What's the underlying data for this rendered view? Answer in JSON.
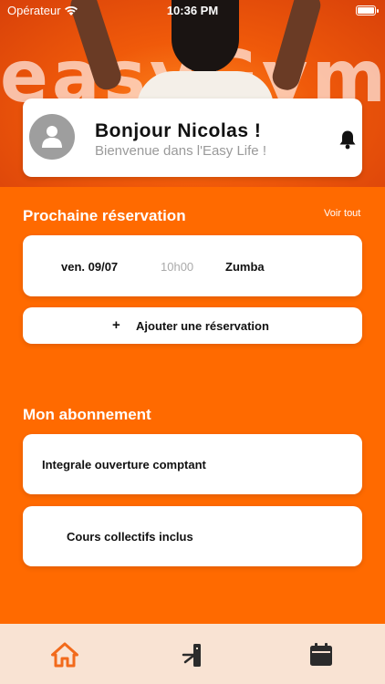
{
  "status_bar": {
    "carrier": "Opérateur",
    "time": "10:36 PM"
  },
  "hero": {
    "brand": "easyGym"
  },
  "greeting": {
    "title": "Bonjour Nicolas  !",
    "subtitle": "Bienvenue dans l'Easy Life !"
  },
  "reservations": {
    "title": "Prochaine réservation",
    "see_all": "Voir tout",
    "next": {
      "date": "ven. 09/07",
      "time": "10h00",
      "activity": "Zumba"
    },
    "add_plus": "+",
    "add_label": "Ajouter une réservation"
  },
  "subscription": {
    "title": "Mon abonnement",
    "plan": "Integrale ouverture comptant",
    "feature": "Cours collectifs inclus"
  },
  "tabbar": {
    "items": [
      {
        "icon": "home-icon",
        "active": true
      },
      {
        "icon": "turnstile-icon",
        "active": false
      },
      {
        "icon": "calendar-icon",
        "active": false
      }
    ]
  },
  "colors": {
    "accent": "#ff6a00",
    "tab_active": "#f26a1b",
    "tab_inactive": "#2b2b2b",
    "tabbar_bg": "#f9e3d3"
  }
}
